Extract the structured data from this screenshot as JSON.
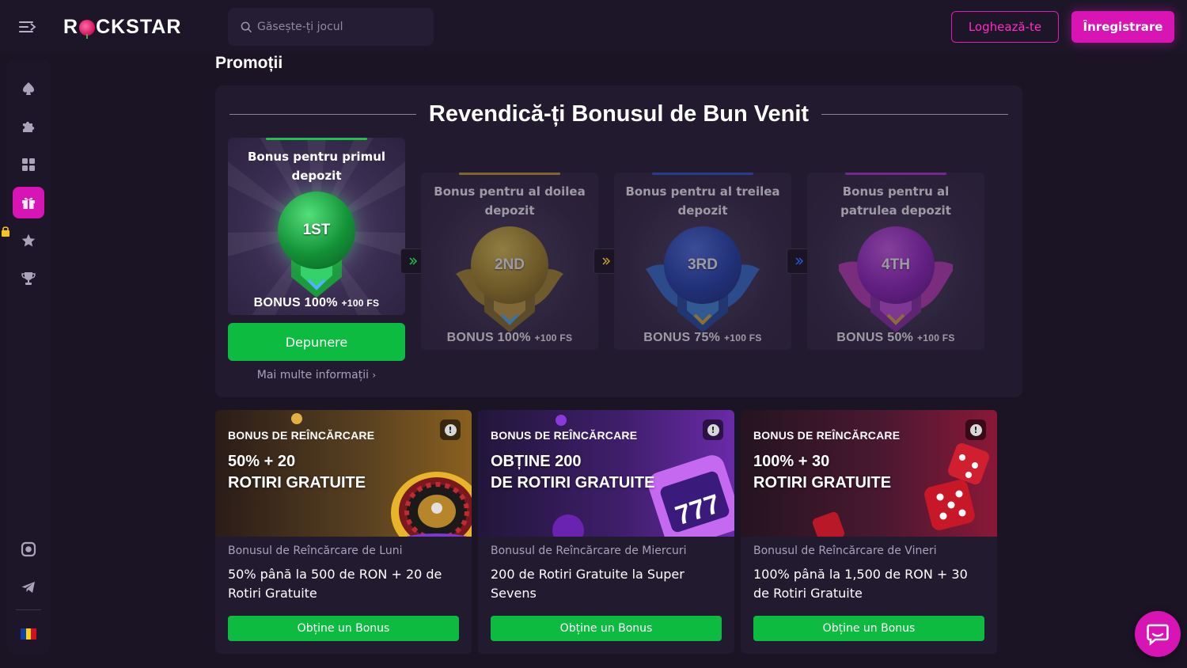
{
  "header": {
    "logo": "ROCKSTAR",
    "search_placeholder": "Găsește-ți jocul",
    "login_label": "Loghează-te",
    "register_label": "Înregistrare"
  },
  "sidebar": {
    "items": [
      {
        "name": "spade-icon"
      },
      {
        "name": "puzzle-icon"
      },
      {
        "name": "grid-icon"
      },
      {
        "name": "gift-icon",
        "active": true
      },
      {
        "name": "star-icon"
      },
      {
        "name": "trophy-icon"
      }
    ],
    "bottom": [
      "instagram-icon",
      "telegram-icon"
    ],
    "language_flag": "RO"
  },
  "page": {
    "title": "Promoții"
  },
  "welcome": {
    "title": "Revendică-ți Bonusul de Bun Venit",
    "deposits": [
      {
        "label": "Bonus pentru primul depozit",
        "orb": "1ST",
        "amount": "BONUS 100%",
        "fs": "+100 FS",
        "accent": "#21c24a"
      },
      {
        "label": "Bonus pentru al doilea depozit",
        "orb": "2ND",
        "amount": "BONUS 100%",
        "fs": "+100 FS",
        "accent": "#c9a12a"
      },
      {
        "label": "Bonus pentru al treilea depozit",
        "orb": "3RD",
        "amount": "BONUS 75%",
        "fs": "+100 FS",
        "accent": "#2b56d6"
      },
      {
        "label": "Bonus pentru al patrulea depozit",
        "orb": "4TH",
        "amount": "BONUS 50%",
        "fs": "+100 FS",
        "accent": "#b530d8"
      }
    ],
    "deposit_button": "Depunere",
    "more_info": "Mai multe informații"
  },
  "promos": [
    {
      "tag": "BONUS DE REÎNCĂRCARE",
      "headline_1": "50% + 20",
      "headline_2": "ROTIRI GRATUITE",
      "subtitle": "Bonusul de Reîncărcare de Luni",
      "desc": "50% până la 500 de RON + 20 de Rotiri Gratuite",
      "button": "Obține un Bonus"
    },
    {
      "tag": "BONUS DE REÎNCĂRCARE",
      "headline_1": "OBȚINE 200",
      "headline_2": "DE ROTIRI GRATUITE",
      "subtitle": "Bonusul de Reîncărcare de Miercuri",
      "desc": "200 de Rotiri Gratuite la Super Sevens",
      "button": "Obține un Bonus"
    },
    {
      "tag": "BONUS DE REÎNCĂRCARE",
      "headline_1": "100% + 30",
      "headline_2": "ROTIRI GRATUITE",
      "subtitle": "Bonusul de Reîncărcare de Vineri",
      "desc": "100% până la 1,500 de RON + 30 de Rotiri Gratuite",
      "button": "Obține un Bonus"
    }
  ],
  "colors": {
    "accent_pink": "#d814b5",
    "green": "#0cbb3f",
    "background": "#1a1425",
    "panel": "#221b30"
  }
}
